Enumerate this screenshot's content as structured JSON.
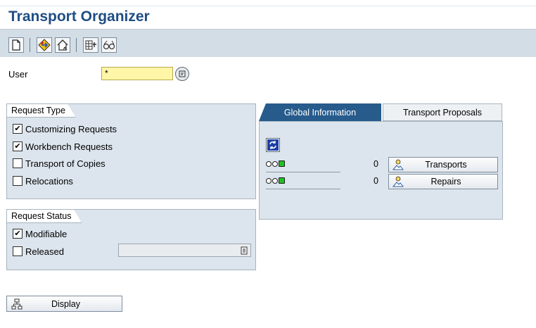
{
  "app": {
    "title": "Transport Organizer"
  },
  "toolbar": {
    "icons": [
      "new-document-icon",
      "transport-diamond-icon",
      "house-icon",
      "table-settings-icon",
      "glasses-icon"
    ]
  },
  "user_field": {
    "label": "User",
    "value": "*"
  },
  "request_type": {
    "title": "Request Type",
    "items": [
      {
        "label": "Customizing Requests",
        "checked": true
      },
      {
        "label": "Workbench Requests",
        "checked": true
      },
      {
        "label": "Transport of Copies",
        "checked": false
      },
      {
        "label": "Relocations",
        "checked": false
      }
    ]
  },
  "request_status": {
    "title": "Request Status",
    "items": [
      {
        "label": "Modifiable",
        "checked": true
      },
      {
        "label": "Released",
        "checked": false
      }
    ],
    "released_select_value": ""
  },
  "tabs": {
    "active": "Global Information",
    "items": [
      {
        "label": "Global Information"
      },
      {
        "label": "Transport Proposals"
      }
    ]
  },
  "global_info": {
    "rows": [
      {
        "count": "0",
        "button_label": "Transports"
      },
      {
        "count": "0",
        "button_label": "Repairs"
      }
    ]
  },
  "display_button": {
    "label": "Display"
  },
  "colors": {
    "title": "#1f4e85",
    "toolbar_bg": "#d3dde6",
    "group_bg": "#dce5ed",
    "active_tab": "#265b8c",
    "required_input": "#fff6a8",
    "status_green": "#1fc21f"
  }
}
